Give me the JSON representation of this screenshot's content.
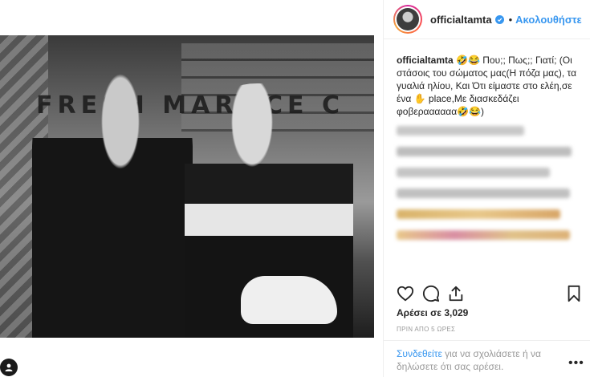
{
  "post": {
    "username": "officialtamta",
    "dot": "•",
    "follow_label": "Ακολουθήστε",
    "caption_user": "officialtamta",
    "caption_text": " 🤣😂 Που;; Πως;; Γιατί; (Οι στάσοις του σώματος μας(Η πόζα μας), τα γυαλιά ηλίου, Και Ότι είμαστε στο ελέη,σε ένα ✋ place,Με διασκεδάζει φοβεραααααα🤣😂)",
    "photo_sign": "FRESH MAR  ICE C",
    "likes": "Αρέσει σε 3,029",
    "time": "ΠΡΙΝ ΑΠΟ 5 ΩΡΕΣ",
    "login_link": "Συνδεθείτε",
    "login_text": " για να σχολιάσετε ή να δηλώσετε ότι σας αρέσει.",
    "more_label": "•••"
  },
  "icons": {
    "heart": "heart-icon",
    "comment": "comment-icon",
    "share": "share-icon",
    "bookmark": "bookmark-icon",
    "tag": "person-tag-icon",
    "verified": "verified-badge-icon"
  },
  "colors": {
    "link": "#3897f0",
    "text": "#262626",
    "muted": "#999999"
  }
}
